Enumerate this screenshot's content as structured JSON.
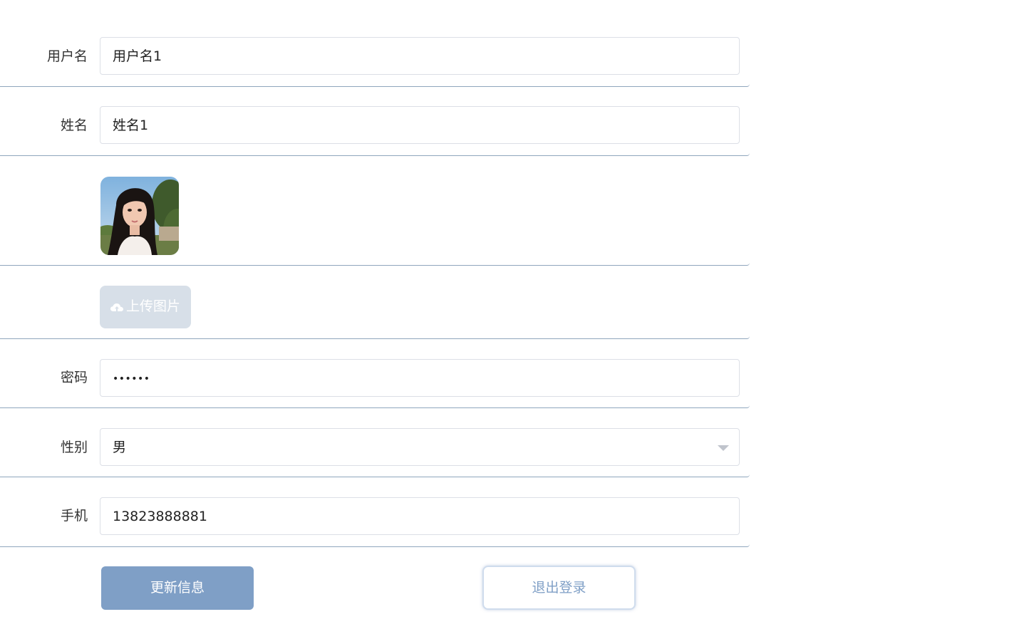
{
  "form": {
    "username": {
      "label": "用户名",
      "value": "用户名1"
    },
    "name": {
      "label": "姓名",
      "value": "姓名1"
    },
    "avatar": {
      "icon": "avatar-photo"
    },
    "upload": {
      "label": "上传图片",
      "icon": "cloud-upload-icon"
    },
    "password": {
      "label": "密码",
      "value": "••••••"
    },
    "gender": {
      "label": "性别",
      "value": "男",
      "icon": "chevron-down-icon"
    },
    "phone": {
      "label": "手机",
      "value": "13823888881"
    }
  },
  "actions": {
    "update_label": "更新信息",
    "logout_label": "退出登录"
  },
  "colors": {
    "primary": "#7f9fc6",
    "divider": "#8fa6bd",
    "upload_bg": "#d7dfe8",
    "input_border": "#dcdfe6"
  }
}
